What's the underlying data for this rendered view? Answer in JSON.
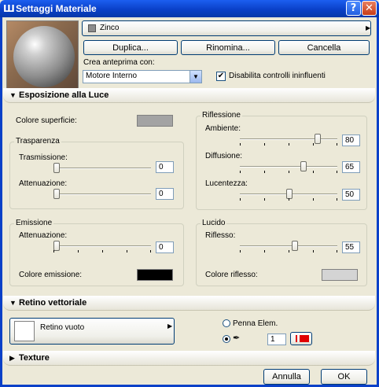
{
  "window": {
    "title": "Settaggi Materiale"
  },
  "material": {
    "name": "Zinco",
    "swatch_color": "#8c8c8c"
  },
  "buttons": {
    "duplicate": "Duplica...",
    "rename": "Rinomina...",
    "delete": "Cancella",
    "cancel": "Annulla",
    "ok": "OK"
  },
  "preview": {
    "label": "Crea anteprima con:",
    "engine": "Motore Interno",
    "disable_label": "Disabilita controlli ininfluenti",
    "disable_checked": true
  },
  "section_light": {
    "title": "Esposizione alla Luce"
  },
  "surface": {
    "label": "Colore superficie:",
    "color": "#a3a3a3"
  },
  "transparency": {
    "title": "Trasparenza",
    "transmission_label": "Trasmissione:",
    "transmission_value": "0",
    "attenuation_label": "Attenuazione:",
    "attenuation_value": "0"
  },
  "reflection": {
    "title": "Riflessione",
    "ambient_label": "Ambiente:",
    "ambient_value": "80",
    "diffusion_label": "Diffusione:",
    "diffusion_value": "65",
    "shininess_label": "Lucentezza:",
    "shininess_value": "50"
  },
  "emission": {
    "title": "Emissione",
    "attenuation_label": "Attenuazione:",
    "attenuation_value": "0",
    "color_label": "Colore emissione:",
    "color": "#000000"
  },
  "gloss": {
    "title": "Lucido",
    "reflection_label": "Riflesso:",
    "reflection_value": "55",
    "color_label": "Colore riflesso:",
    "color": "#d4d4d4"
  },
  "section_vector": {
    "title": "Retino vettoriale"
  },
  "vector": {
    "fill_label": "Retino vuoto",
    "pen_label": "Penna Elem.",
    "pen_value": "1",
    "pen_color": "#e00000"
  },
  "section_texture": {
    "title": "Texture"
  }
}
